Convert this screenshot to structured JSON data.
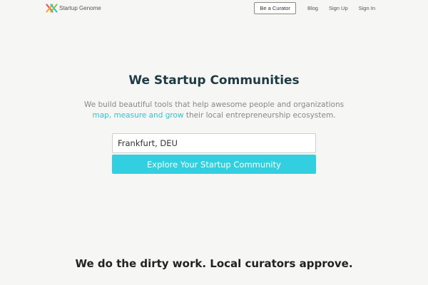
{
  "header": {
    "logo_text": "Startup Genome",
    "curator_button": "Be a Curator",
    "nav": {
      "blog": "Blog",
      "signup": "Sign Up",
      "signin": "Sign In"
    }
  },
  "hero": {
    "title": "We Startup Communities",
    "subtitle_line1": "We build beautiful tools that help awesome people and organizations",
    "subtitle_highlight": "map, measure and grow",
    "subtitle_rest": " their local entrepreneurship ecosystem."
  },
  "search": {
    "value": "Frankfurt, DEU",
    "button_label": "Explore Your Startup Community"
  },
  "tagline": "We do the dirty work. Local curators approve.",
  "colors": {
    "accent": "#32cfe0",
    "highlight_text": "#2cc5d6",
    "title": "#1f3b45",
    "background": "#f6f6f5"
  },
  "icons": {
    "logo": "startup-genome-logo-icon"
  }
}
